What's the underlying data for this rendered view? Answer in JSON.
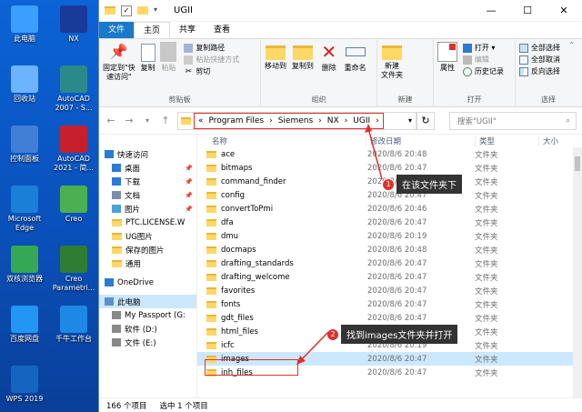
{
  "desktop": {
    "icons": [
      {
        "label": "此电脑",
        "icon": "computer-icon",
        "color": "#3aa0ff"
      },
      {
        "label": "NX",
        "icon": "nx-icon",
        "color": "#1a3a9a"
      },
      {
        "label": "回收站",
        "icon": "recycle-bin-icon",
        "color": "#6cb4ff"
      },
      {
        "label": "AutoCAD 2007 - S...",
        "icon": "autocad-2007-icon",
        "color": "#2a8a8a"
      },
      {
        "label": "控制面板",
        "icon": "control-panel-icon",
        "color": "#3f7fd6"
      },
      {
        "label": "AutoCAD 2021 - 简...",
        "icon": "autocad-2021-icon",
        "color": "#c8202a"
      },
      {
        "label": "Microsoft Edge",
        "icon": "edge-icon",
        "color": "#1a7fd6"
      },
      {
        "label": "Creo",
        "icon": "creo-icon",
        "color": "#4caf50"
      },
      {
        "label": "双核浏览器",
        "icon": "browser-icon",
        "color": "#34a853"
      },
      {
        "label": "Creo Parametri...",
        "icon": "creo-parametric-icon",
        "color": "#2e7d32"
      },
      {
        "label": "百度网盘",
        "icon": "baidu-netdisk-icon",
        "color": "#2196f3"
      },
      {
        "label": "千牛工作台",
        "icon": "qianniu-icon",
        "color": "#1e88e5"
      },
      {
        "label": "WPS 2019",
        "icon": "wps-icon",
        "color": "#1565c0"
      }
    ]
  },
  "window": {
    "title": "UGII",
    "controls": {
      "minimize": "—",
      "maximize": "☐",
      "close": "✕"
    }
  },
  "tabs": [
    "文件",
    "主页",
    "共享",
    "查看"
  ],
  "ribbon": {
    "clipboard": {
      "pin": "固定到\"快\n速访问\"",
      "copy": "复制",
      "paste": "粘贴",
      "copy_path": "复制路径",
      "paste_shortcut": "粘贴快捷方式",
      "cut": "剪切",
      "label": "剪贴板"
    },
    "organize": {
      "move_to": "移动到",
      "copy_to": "复制到",
      "delete": "删除",
      "rename": "重命名",
      "label": "组织"
    },
    "new": {
      "new_folder": "新建\n文件夹",
      "label": "新建"
    },
    "open": {
      "properties": "属性",
      "open": "打开 ▾",
      "edit": "编辑",
      "history": "历史记录",
      "label": "打开"
    },
    "select": {
      "select_all": "全部选择",
      "select_none": "全部取消",
      "invert": "反向选择",
      "label": "选择"
    }
  },
  "address": {
    "crumbs": [
      "«",
      "Program Files",
      "›",
      "Siemens",
      "›",
      "NX",
      "›",
      "UGII",
      "›"
    ],
    "search_placeholder": "搜索\"UGII\""
  },
  "nav": [
    {
      "label": "快速访问",
      "kind": "star"
    },
    {
      "label": "桌面",
      "kind": "desktop"
    },
    {
      "label": "下载",
      "kind": "download"
    },
    {
      "label": "文档",
      "kind": "docs"
    },
    {
      "label": "图片",
      "kind": "pics"
    },
    {
      "label": "PTC.LICENSE.W",
      "kind": "folder"
    },
    {
      "label": "UG图片",
      "kind": "folder"
    },
    {
      "label": "保存的图片",
      "kind": "folder"
    },
    {
      "label": "通用",
      "kind": "folder"
    },
    {
      "label": "OneDrive",
      "kind": "cloud"
    },
    {
      "label": "此电脑",
      "kind": "pc"
    },
    {
      "label": "My Passport (G:",
      "kind": "drive"
    },
    {
      "label": "软件 (D:)",
      "kind": "drive"
    },
    {
      "label": "文件 (E:)",
      "kind": "drive"
    }
  ],
  "columns": {
    "name": "名称",
    "date": "修改日期",
    "type": "类型",
    "size": "大小"
  },
  "files": [
    {
      "name": "ace",
      "date": "2020/8/6 20:48",
      "type": "文件夹"
    },
    {
      "name": "bitmaps",
      "date": "2020/8/6 20:47",
      "type": "文件夹"
    },
    {
      "name": "command_finder",
      "date": "2020/8/6 20:47",
      "type": "文件夹"
    },
    {
      "name": "config",
      "date": "2020/8/6 20:47",
      "type": "文件夹"
    },
    {
      "name": "convertToPmi",
      "date": "2020/8/6 20:46",
      "type": "文件夹"
    },
    {
      "name": "dfa",
      "date": "2020/8/6 20:47",
      "type": "文件夹"
    },
    {
      "name": "dmu",
      "date": "2020/8/6 20:19",
      "type": "文件夹"
    },
    {
      "name": "docmaps",
      "date": "2020/8/6 20:48",
      "type": "文件夹"
    },
    {
      "name": "drafting_standards",
      "date": "2020/8/6 20:47",
      "type": "文件夹"
    },
    {
      "name": "drafting_welcome",
      "date": "2020/8/6 20:47",
      "type": "文件夹"
    },
    {
      "name": "favorites",
      "date": "2020/8/6 20:47",
      "type": "文件夹"
    },
    {
      "name": "fonts",
      "date": "2020/8/6 20:47",
      "type": "文件夹"
    },
    {
      "name": "gdt_files",
      "date": "2020/8/6 20:47",
      "type": "文件夹"
    },
    {
      "name": "html_files",
      "date": "2020/8/6 20:47",
      "type": "文件夹"
    },
    {
      "name": "icfc",
      "date": "2020/8/6 20:19",
      "type": "文件夹"
    },
    {
      "name": "images",
      "date": "2020/8/6 20:47",
      "type": "文件夹"
    },
    {
      "name": "inh_files",
      "date": "2020/8/6 20:47",
      "type": "文件夹"
    }
  ],
  "status": {
    "count": "166 个项目",
    "selected": "选中 1 个项目"
  },
  "callouts": [
    {
      "num": "1",
      "text": "在该文件夹下"
    },
    {
      "num": "2",
      "text": "找到images文件夹并打开"
    }
  ],
  "colors": {
    "accent": "#1979ca",
    "highlight": "#e0302d",
    "selection": "#cce8ff"
  }
}
